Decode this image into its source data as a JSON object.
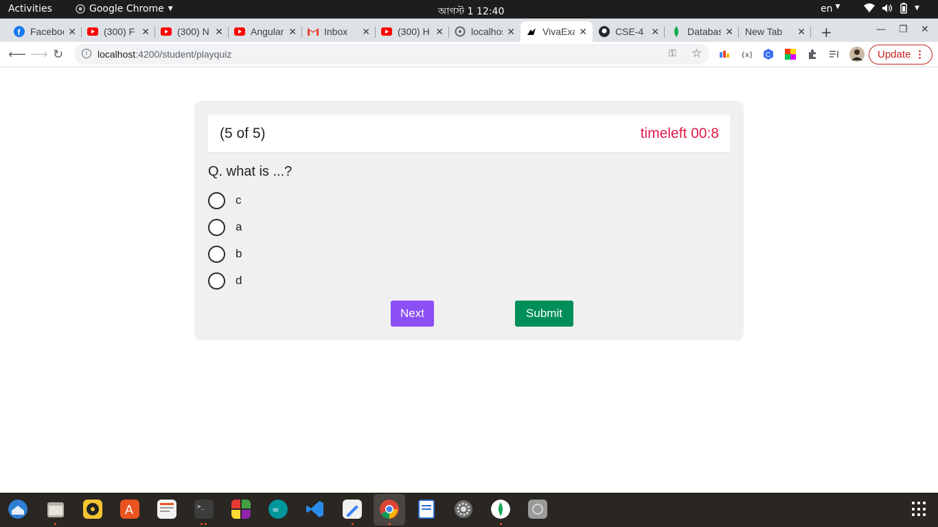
{
  "topbar": {
    "activities": "Activities",
    "app_name": "Google Chrome",
    "clock": "আগস্ট 1  12:40",
    "lang": "en"
  },
  "tabs": [
    {
      "title": "Facebook",
      "icon": "facebook-icon",
      "color": "#1877f2"
    },
    {
      "title": "(300) F",
      "icon": "youtube-icon",
      "color": "#ff0000"
    },
    {
      "title": "(300) N",
      "icon": "youtube-icon",
      "color": "#ff0000"
    },
    {
      "title": "Angular",
      "icon": "youtube-icon",
      "color": "#ff0000"
    },
    {
      "title": "Inbox",
      "icon": "gmail-icon",
      "color": "#ea4335"
    },
    {
      "title": "(300) H",
      "icon": "youtube-icon",
      "color": "#ff0000"
    },
    {
      "title": "localhost",
      "icon": "globe-icon",
      "color": "#5f6368"
    },
    {
      "title": "VivaExam",
      "icon": "vivaexam-icon",
      "color": "#000000",
      "active": true
    },
    {
      "title": "CSE-4",
      "icon": "github-icon",
      "color": "#24292e"
    },
    {
      "title": "Database",
      "icon": "mongodb-leaf-icon",
      "color": "#13aa52"
    },
    {
      "title": "New Tab",
      "icon": "",
      "color": ""
    }
  ],
  "address": {
    "host": "localhost",
    "path": ":4200/student/playquiz"
  },
  "update_label": "Update",
  "quiz": {
    "count": "(5 of 5)",
    "timer": "timeleft 00:8",
    "question": "Q. what is ...?",
    "options": [
      "c",
      "a",
      "b",
      "d"
    ],
    "next_label": "Next",
    "submit_label": "Submit"
  },
  "colors": {
    "timer": "#dc1b47",
    "next": "#8c4ff5",
    "submit": "#008f58"
  }
}
